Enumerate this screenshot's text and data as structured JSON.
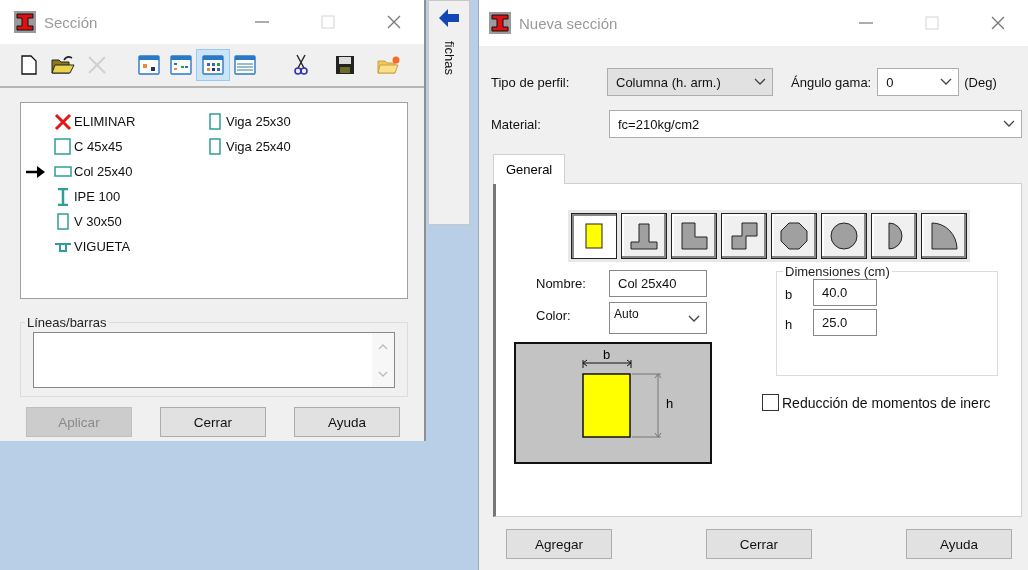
{
  "left_window": {
    "title": "Sección",
    "toolbar": [
      {
        "kind": "new",
        "selected": false,
        "disabled": false
      },
      {
        "kind": "open",
        "selected": false,
        "disabled": false
      },
      {
        "kind": "delete",
        "selected": false,
        "disabled": true
      },
      {
        "kind": "view_large",
        "selected": false,
        "disabled": false
      },
      {
        "kind": "view_small",
        "selected": false,
        "disabled": false
      },
      {
        "kind": "view_list",
        "selected": true,
        "disabled": false
      },
      {
        "kind": "view_details",
        "selected": false,
        "disabled": false
      },
      {
        "kind": "cut",
        "selected": false,
        "disabled": false
      },
      {
        "kind": "save",
        "selected": false,
        "disabled": false
      },
      {
        "kind": "new_folder",
        "selected": false,
        "disabled": false
      }
    ],
    "sections": [
      {
        "label": "ELIMINAR",
        "kind": "delete",
        "current": false
      },
      {
        "label": "C 45x45",
        "kind": "square",
        "current": false
      },
      {
        "label": "Col 25x40",
        "kind": "wide",
        "current": true
      },
      {
        "label": "IPE 100",
        "kind": "ibeam",
        "current": false
      },
      {
        "label": "V 30x50",
        "kind": "tall",
        "current": false
      },
      {
        "label": "VIGUETA",
        "kind": "joist",
        "current": false
      },
      {
        "label": "Viga 25x30",
        "kind": "tall",
        "current": false
      },
      {
        "label": "Viga 25x40",
        "kind": "tall",
        "current": false
      }
    ],
    "lines_group": {
      "legend": "Líneas/barras"
    },
    "buttons": [
      {
        "label": "Aplicar",
        "disabled": true
      },
      {
        "label": "Cerrar",
        "disabled": false
      },
      {
        "label": "Ayuda",
        "disabled": false
      }
    ]
  },
  "side_tab": {
    "label": "fichas"
  },
  "right_window": {
    "title": "Nueva sección",
    "profile_type": {
      "label": "Tipo de perfil:",
      "value": "Columna (h. arm.)"
    },
    "gamma_angle": {
      "label": "Ángulo gama:",
      "value": "0",
      "unit": "(Deg)"
    },
    "material": {
      "label": "Material:",
      "value": "fc=210kg/cm2"
    },
    "tabs": [
      {
        "label": "General",
        "selected": true
      }
    ],
    "shapes": [
      {
        "kind": "rectangle",
        "selected": true
      },
      {
        "kind": "tee",
        "selected": false
      },
      {
        "kind": "ell",
        "selected": false
      },
      {
        "kind": "zee",
        "selected": false
      },
      {
        "kind": "octagon",
        "selected": false
      },
      {
        "kind": "circle",
        "selected": false
      },
      {
        "kind": "half_circle",
        "selected": false
      },
      {
        "kind": "quarter_circle",
        "selected": false
      }
    ],
    "name": {
      "label": "Nombre:",
      "value": "Col 25x40"
    },
    "color": {
      "label": "Color:",
      "value": "Auto"
    },
    "preview": {
      "width_label": "b",
      "height_label": "h"
    },
    "dimensions": {
      "legend": "Dimensiones (cm)",
      "rows": [
        {
          "label": "b",
          "value": "40.0"
        },
        {
          "label": "h",
          "value": "25.0"
        }
      ]
    },
    "inertia_reduction": {
      "label": "Reducción de momentos de inerc",
      "checked": false
    },
    "buttons": [
      {
        "label": "Agregar",
        "disabled": false
      },
      {
        "label": "Cerrar",
        "disabled": false
      },
      {
        "label": "Ayuda",
        "disabled": false
      }
    ]
  }
}
